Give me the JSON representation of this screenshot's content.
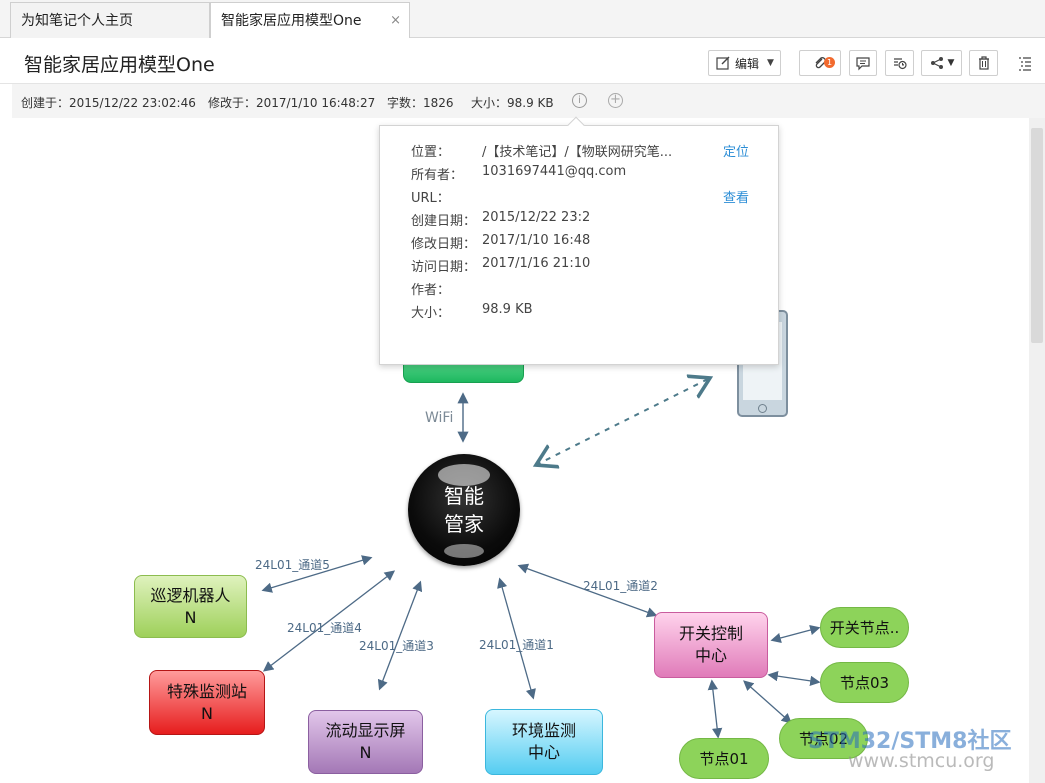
{
  "tabs": [
    {
      "label": "为知笔记个人主页"
    },
    {
      "label": "智能家居应用模型One",
      "close": "×"
    }
  ],
  "toolbar": {
    "title": "智能家居应用模型One",
    "edit_label": "编辑",
    "attach_count": "1"
  },
  "meta": {
    "created": "创建于：2015/12/22 23:02:46",
    "modified": "修改于：2017/1/10 16:48:27",
    "word_count": "字数：1826",
    "size": "大小：98.9 KB"
  },
  "popup": {
    "rows": [
      {
        "label": "位置：",
        "value": "/【技术笔记】/【物联网研究笔..."
      },
      {
        "label": "所有者：",
        "value": "1031697441@qq.com"
      },
      {
        "label": "URL：",
        "value": ""
      },
      {
        "label": "创建日期：",
        "value": "2015/12/22 23:2"
      },
      {
        "label": "修改日期：",
        "value": "2017/1/10 16:48"
      },
      {
        "label": "访问日期：",
        "value": "2017/1/16 21:10"
      },
      {
        "label": "作者：",
        "value": ""
      },
      {
        "label": "大小：",
        "value": "98.9 KB"
      }
    ],
    "locate_link": "定位",
    "view_link": "查看"
  },
  "diagram": {
    "hub": {
      "line1": "智能",
      "line2": "管家"
    },
    "wifi": "WiFi",
    "nodes": {
      "patrol": {
        "line1": "巡逻机器人",
        "line2": "N"
      },
      "special": {
        "line1": "特殊监测站",
        "line2": "N"
      },
      "display": {
        "line1": "流动显示屏",
        "line2": "N"
      },
      "env": {
        "line1": "环境监测",
        "line2": "中心"
      },
      "switch": {
        "line1": "开关控制",
        "line2": "中心"
      }
    },
    "pills": [
      "开关节点..",
      "节点03",
      "节点02",
      "节点01"
    ],
    "edges": [
      "24L01_通道5",
      "24L01_通道4",
      "24L01_通道3",
      "24L01_通道1",
      "24L01_通道2"
    ]
  },
  "watermark": {
    "line1": "STM32/STM8社区",
    "line2": "www.stmcu.org"
  },
  "colors": {
    "link": "#2c8ed6",
    "edge": "#4d6a86",
    "badge": "#f26a2e"
  }
}
